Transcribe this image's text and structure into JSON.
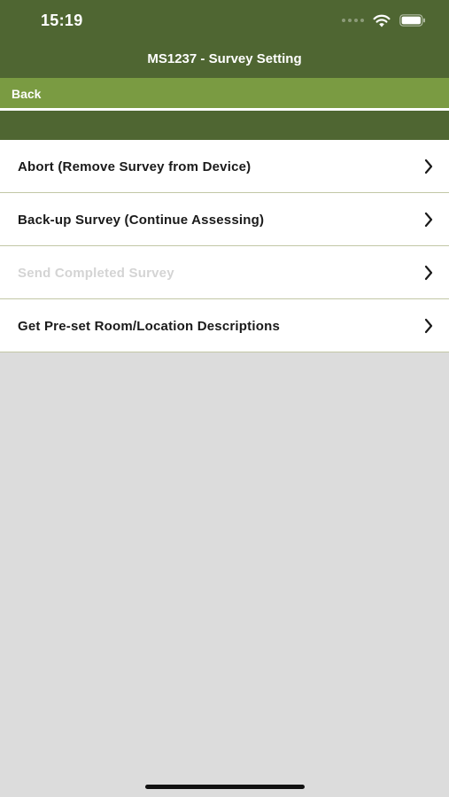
{
  "status_bar": {
    "time": "15:19",
    "wifi_icon": "wifi-icon",
    "battery_icon": "battery-icon"
  },
  "header": {
    "title": "MS1237 - Survey Setting"
  },
  "back_bar": {
    "back_label": "Back"
  },
  "menu": {
    "items": [
      {
        "label": "Abort (Remove Survey from Device)",
        "enabled": true,
        "icon": "chevron-right-icon"
      },
      {
        "label": "Back-up Survey (Continue Assessing)",
        "enabled": true,
        "icon": "chevron-right-icon"
      },
      {
        "label": "Send Completed Survey",
        "enabled": false,
        "icon": "chevron-right-icon"
      },
      {
        "label": "Get Pre-set Room/Location Descriptions",
        "enabled": true,
        "icon": "chevron-right-icon"
      }
    ]
  },
  "colors": {
    "header_dark_green": "#4f6632",
    "back_bar_green": "#7a9b42",
    "background_gray": "#dcdcdc",
    "disabled_text": "#d4d4d4"
  }
}
